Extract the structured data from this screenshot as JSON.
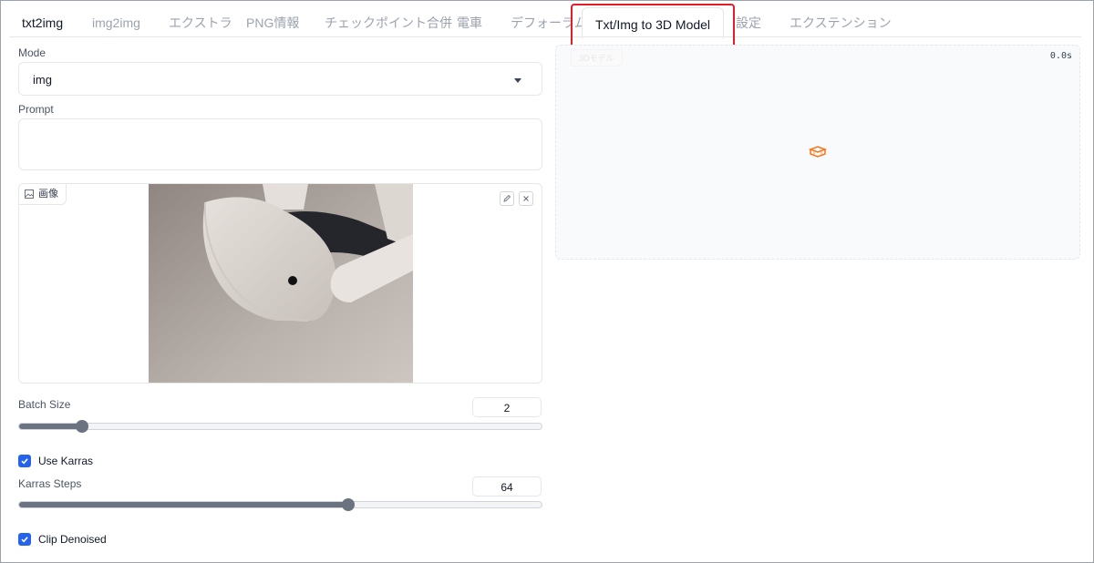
{
  "tabs": [
    {
      "label": "txt2img"
    },
    {
      "label": "img2img"
    },
    {
      "label": "エクストラ"
    },
    {
      "label": "PNG情報"
    },
    {
      "label": "チェックポイント合併"
    },
    {
      "label": "電車"
    },
    {
      "label": "デフォーラム"
    },
    {
      "label": "Txt/Img to 3D Model",
      "selected": true
    },
    {
      "label": "設定"
    },
    {
      "label": "エクステンション"
    }
  ],
  "mode": {
    "label": "Mode",
    "value": "img"
  },
  "prompt": {
    "label": "Prompt",
    "value": ""
  },
  "image_input": {
    "tag": "画像"
  },
  "batch_size": {
    "label": "Batch Size",
    "value": 2,
    "fraction": 0.12
  },
  "use_karras": {
    "label": "Use Karras",
    "checked": true
  },
  "karras_steps": {
    "label": "Karras Steps",
    "value": 64,
    "fraction": 0.63
  },
  "clip_denoised": {
    "label": "Clip Denoised",
    "checked": true
  },
  "output": {
    "tag": "3Dモデル",
    "time": "0.0s"
  },
  "colors": {
    "accent": "#2563eb",
    "highlight": "#e11d2a",
    "output_icon": "#f97316"
  }
}
